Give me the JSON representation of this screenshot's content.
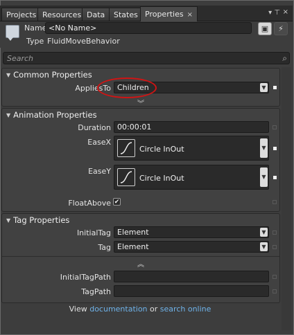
{
  "tabs": [
    {
      "label": "Projects"
    },
    {
      "label": "Resources"
    },
    {
      "label": "Data"
    },
    {
      "label": "States"
    },
    {
      "label": "Properties",
      "close": "×",
      "active": true
    }
  ],
  "tab_strip": {
    "pin": "▾ ⊤",
    "close": "×"
  },
  "header": {
    "name_label": "Name",
    "name_value": "<No Name>",
    "type_label": "Type",
    "type_value": "FluidMoveBehavior"
  },
  "search": {
    "placeholder": "Search"
  },
  "common": {
    "title": "Common Properties",
    "applies_to_label": "AppliesTo",
    "applies_to_value": "Children"
  },
  "animation": {
    "title": "Animation Properties",
    "duration_label": "Duration",
    "duration_value": "00:00:01",
    "easex_label": "EaseX",
    "easex_value": "Circle InOut",
    "easey_label": "EaseY",
    "easey_value": "Circle InOut",
    "floatabove_label": "FloatAbove",
    "floatabove_checked": true
  },
  "tag": {
    "title": "Tag Properties",
    "initialtag_label": "InitialTag",
    "initialtag_value": "Element",
    "tag_label": "Tag",
    "tag_value": "Element",
    "initialtagpath_label": "InitialTagPath",
    "initialtagpath_value": "",
    "tagpath_label": "TagPath",
    "tagpath_value": ""
  },
  "footer": {
    "prefix": "View",
    "documentation_link": "documentation",
    "middle": "or",
    "search_online_link": "search online"
  },
  "colors": {
    "link": "#6fb3ea",
    "annotation": "#d01414",
    "panel": "#414141"
  }
}
